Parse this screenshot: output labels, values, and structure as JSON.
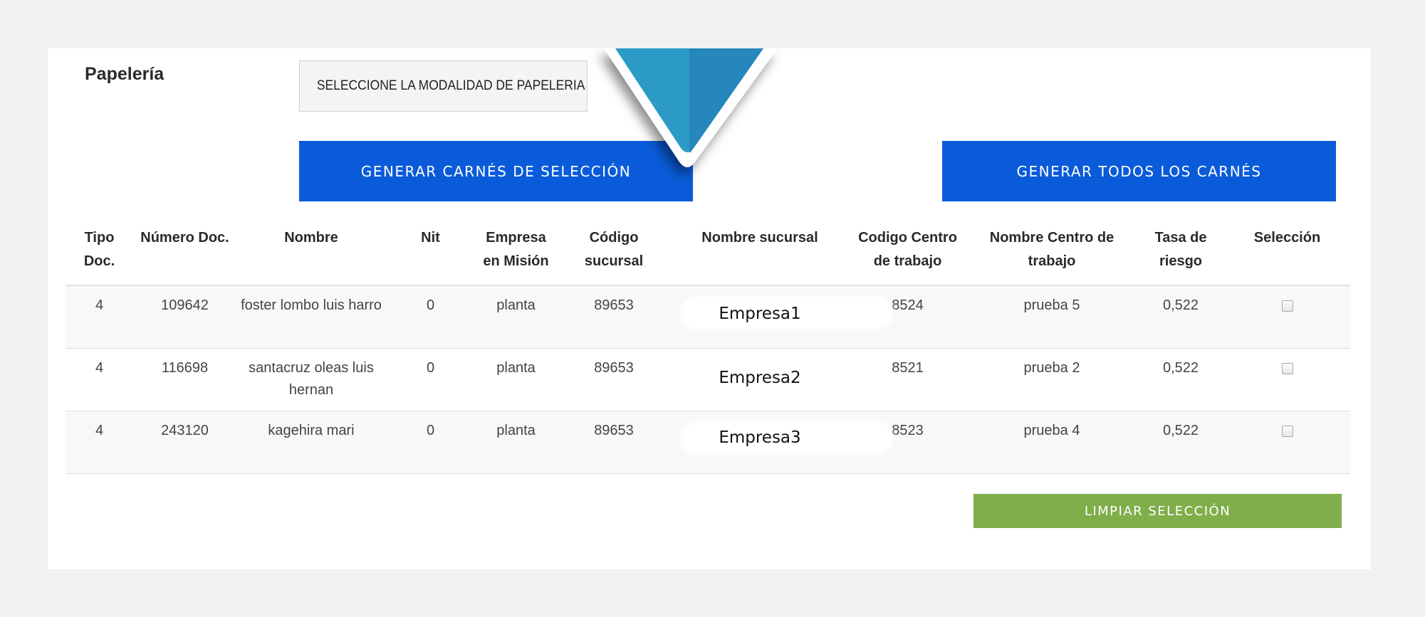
{
  "papeleria": {
    "label": "Papelería",
    "select_value": "SELECCIONE LA MODALIDAD DE PAPELERIA"
  },
  "buttons": {
    "generate_selected": "GENERAR CARNÉS DE SELECCIÓN",
    "generate_all": "GENERAR TODOS LOS CARNÉS",
    "clear_selection": "LIMPIAR SELECCIÓN"
  },
  "colors": {
    "primary_button": "#0a5bd9",
    "clear_button": "#7fae4b",
    "arrow_overlay": "#2a9ac6"
  },
  "table": {
    "headers": {
      "tipo_doc": "Tipo Doc.",
      "numero_doc": "Número Doc.",
      "nombre": "Nombre",
      "nit": "Nit",
      "empresa_mision": "Empresa en Misión",
      "codigo_sucursal": "Código sucursal",
      "nombre_sucursal": "Nombre sucursal",
      "codigo_centro": "Codigo Centro de trabajo",
      "nombre_centro": "Nombre Centro de trabajo",
      "tasa_riesgo": "Tasa de riesgo",
      "seleccion": "Selección"
    },
    "rows": [
      {
        "tipo_doc": "4",
        "numero_doc": "109642",
        "nombre": "foster lombo luis harro",
        "nit": "0",
        "empresa_mision": "planta",
        "codigo_sucursal": "89653",
        "nombre_sucursal": "Empresa1",
        "codigo_centro": "8524",
        "nombre_centro": "prueba 5",
        "tasa_riesgo": "0,522",
        "selected": false
      },
      {
        "tipo_doc": "4",
        "numero_doc": "116698",
        "nombre": "santacruz oleas luis hernan",
        "nit": "0",
        "empresa_mision": "planta",
        "codigo_sucursal": "89653",
        "nombre_sucursal": "Empresa2",
        "codigo_centro": "8521",
        "nombre_centro": "prueba 2",
        "tasa_riesgo": "0,522",
        "selected": false
      },
      {
        "tipo_doc": "4",
        "numero_doc": "243120",
        "nombre": "kagehira mari",
        "nit": "0",
        "empresa_mision": "planta",
        "codigo_sucursal": "89653",
        "nombre_sucursal": "Empresa3",
        "codigo_centro": "8523",
        "nombre_centro": "prueba 4",
        "tasa_riesgo": "0,522",
        "selected": false
      }
    ]
  }
}
